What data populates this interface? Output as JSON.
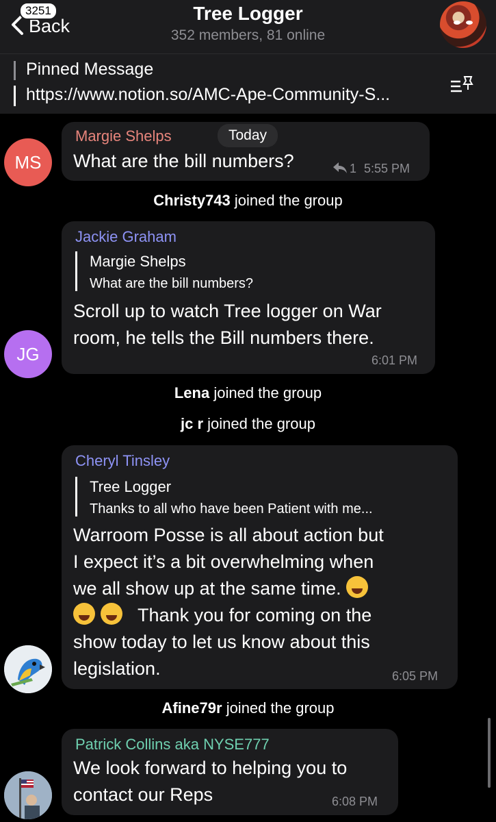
{
  "header": {
    "back_label": "Back",
    "unread_badge": "3251",
    "title": "Tree Logger",
    "subtitle": "352 members, 81 online"
  },
  "pinned": {
    "title": "Pinned Message",
    "text": "https://www.notion.so/AMC-Ape-Community-S..."
  },
  "messages": [
    {
      "avatar_initials": "MS",
      "sender": "Margie Shelps",
      "date_badge": "Today",
      "text": "What are the bill numbers?",
      "reply_count": "1",
      "time": "5:55 PM",
      "colors": {
        "name": "#e7857c",
        "avatar": "#e85b54"
      }
    },
    {
      "avatar_initials": "JG",
      "sender": "Jackie Graham",
      "quote_name": "Margie Shelps",
      "quote_text": "What are the bill numbers?",
      "lines": [
        "Scroll up to watch Tree logger on War",
        "room, he tells the Bill numbers there."
      ],
      "time": "6:01 PM",
      "colors": {
        "name": "#8e93f5",
        "avatar": "#b66ff0"
      }
    },
    {
      "sender": "Cheryl Tinsley",
      "quote_name": "Tree Logger",
      "quote_text": "Thanks to all who have been Patient with me...",
      "lines": [
        "Warroom Posse is all about action but",
        "I expect it’s a bit overwhelming when",
        "we all show up at the same time.",
        "Thank you for coming on the",
        "show today to let us know about this",
        "legislation."
      ],
      "time": "6:05 PM",
      "colors": {
        "name": "#8e93f5"
      }
    },
    {
      "sender": "Patrick Collins aka NYSE777",
      "lines": [
        "We look forward to helping you to",
        "contact our Reps"
      ],
      "time": "6:08 PM",
      "colors": {
        "name": "#6fd0b0"
      }
    }
  ],
  "service": [
    {
      "user": "Christy743",
      "action": "joined the group"
    },
    {
      "user": "Lena",
      "action": "joined the group"
    },
    {
      "user": "jc r",
      "action": "joined the group"
    },
    {
      "user": "Afine79r",
      "action": "joined the group"
    }
  ]
}
